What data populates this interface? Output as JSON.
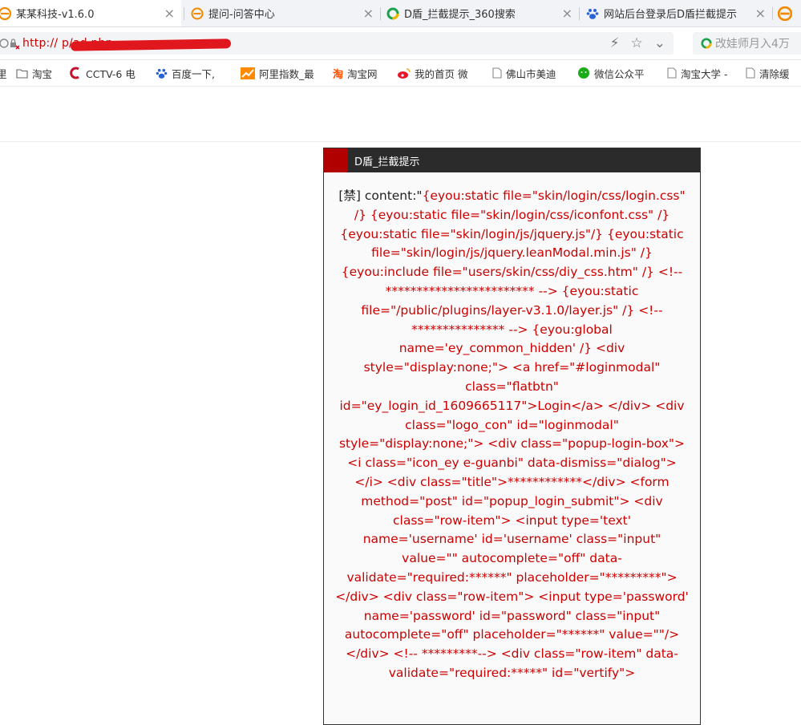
{
  "tabs": [
    {
      "title": "某某科技-v1.6.0",
      "icon": "browser-e-icon",
      "active": true
    },
    {
      "title": "提问-问答中心",
      "icon": "browser-e-icon",
      "active": false
    },
    {
      "title": "D盾_拦截提示_360搜索",
      "icon": "360-search-icon",
      "active": false
    },
    {
      "title": "网站后台登录后D盾拦截提示",
      "icon": "baidu-paw-icon",
      "active": false
    }
  ],
  "address": {
    "url": "http://                    p/ad.php",
    "search_placeholder": "改娃师月入4万"
  },
  "bookmarks": [
    {
      "label": "里",
      "icon": "none"
    },
    {
      "label": "淘宝",
      "icon": "folder-icon"
    },
    {
      "label": "CCTV-6 电",
      "icon": "cctv-icon"
    },
    {
      "label": "百度一下,",
      "icon": "baidu-paw-icon"
    },
    {
      "label": "阿里指数_最",
      "icon": "alizhishu-icon"
    },
    {
      "label": "淘宝网",
      "icon": "taobao-icon"
    },
    {
      "label": "我的首页 微",
      "icon": "weibo-icon"
    },
    {
      "label": "佛山市美迪",
      "icon": "page-icon"
    },
    {
      "label": "微信公众平",
      "icon": "wechat-icon"
    },
    {
      "label": "淘宝大学 -",
      "icon": "page-icon"
    },
    {
      "label": "清除缓",
      "icon": "page-icon"
    }
  ],
  "dialog": {
    "title": "D盾_拦截提示",
    "lead": "[禁] content:\"",
    "content": "{eyou:static file=\"skin/login/css/login.css\" /} {eyou:static file=\"skin/login/css/iconfont.css\" /} {eyou:static file=\"skin/login/js/jquery.js\"/} {eyou:static file=\"skin/login/js/jquery.leanModal.min.js\" /} {eyou:include file=\"users/skin/css/diy_css.htm\" /} <!-- ************************ --> {eyou:static file=\"/public/plugins/layer-v3.1.0/layer.js\" /} <!-- *************** --> {eyou:global name='ey_common_hidden' /} <div style=\"display:none;\"> <a href=\"#loginmodal\" class=\"flatbtn\" id=\"ey_login_id_1609665117\">Login</a> </div> <div class=\"logo_con\" id=\"loginmodal\" style=\"display:none;\"> <div class=\"popup-login-box\"> <i class=\"icon_ey e-guanbi\" data-dismiss=\"dialog\"></i> <div class=\"title\">************</div> <form method=\"post\" id=\"popup_login_submit\"> <div class=\"row-item\"> <input type='text' name='username' id='username' class=\"input\" value=\"\" autocomplete=\"off\" data-validate=\"required:******\" placeholder=\"*********\"> </div> <div class=\"row-item\"> <input type='password' name='password' id=\"password\" class=\"input\" autocomplete=\"off\" placeholder=\"******\" value=\"\"/> </div> <!-- *********--> <div class=\"row-item\" data-validate=\"required:*****\" id=\"vertify\">"
  },
  "colors": {
    "warning_text": "#cc0000",
    "titlebar": "#2b2b2b",
    "title_accent": "#b00000"
  }
}
